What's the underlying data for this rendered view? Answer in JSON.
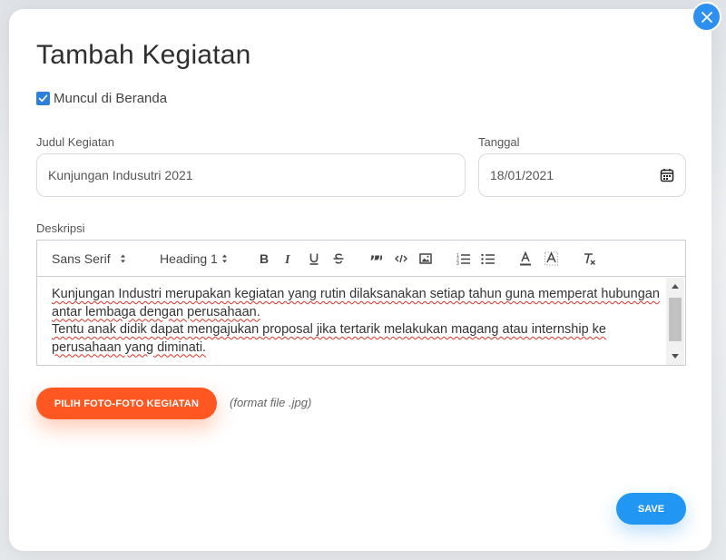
{
  "modal": {
    "title": "Tambah Kegiatan",
    "show_on_home": {
      "label": "Muncul di Beranda",
      "checked": true
    },
    "title_field": {
      "label": "Judul Kegiatan",
      "value": "Kunjungan Indusutri 2021"
    },
    "date_field": {
      "label": "Tanggal",
      "value": "18/01/2021"
    },
    "description": {
      "label": "Deskripsi",
      "toolbar": {
        "font": "Sans Serif",
        "heading": "Heading 1",
        "buttons": [
          "bold-icon",
          "italic-icon",
          "underline-icon",
          "strikethrough-icon",
          "blockquote-icon",
          "code-icon",
          "image-icon",
          "ordered-list-icon",
          "bullet-list-icon",
          "text-color-icon",
          "highlight-icon",
          "clear-format-icon"
        ]
      },
      "paragraphs": [
        "Kunjungan Industri merupakan kegiatan yang rutin dilaksanakan setiap tahun guna memperat hubungan antar lembaga dengan perusahaan.",
        "Tentu anak didik dapat mengajukan proposal jika tertarik melakukan magang atau internship ke perusahaan yang diminati."
      ]
    },
    "photo_button": "PILIH FOTO-FOTO KEGIATAN",
    "format_hint": "(format file .jpg)",
    "save_button": "SAVE"
  },
  "colors": {
    "accent_blue": "#2196f3",
    "accent_orange": "#ff5722",
    "checkbox_blue": "#2d7fd9"
  }
}
